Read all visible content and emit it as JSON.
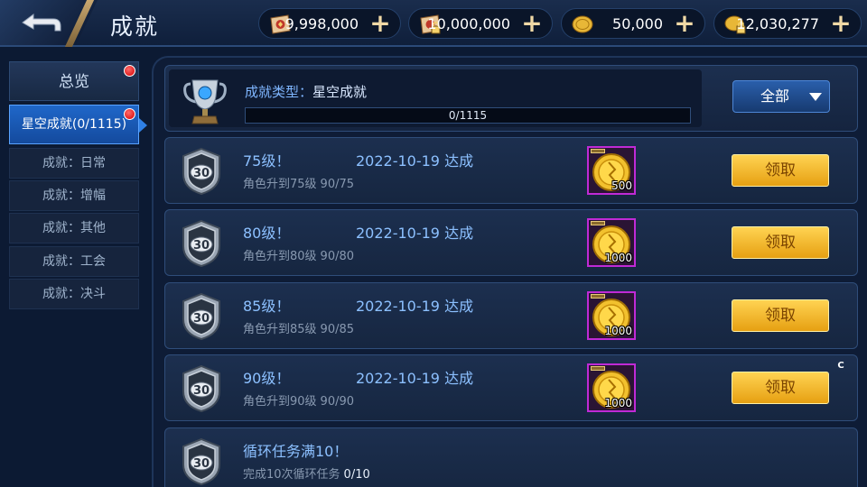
{
  "header": {
    "title": "成就",
    "currencies": [
      {
        "icon": "scroll-ticket-icon",
        "value": "9,998,000"
      },
      {
        "icon": "locked-scroll-ticket-icon",
        "value": "10,000,000"
      },
      {
        "icon": "gold-coin-icon",
        "value": "50,000"
      },
      {
        "icon": "locked-gold-coin-icon",
        "value": "12,030,277"
      }
    ],
    "plus_label": "+"
  },
  "sidebar": {
    "items": [
      {
        "label": "总览",
        "dot": true
      },
      {
        "label": "星空成就(0/1115)",
        "dot": true,
        "active": true
      },
      {
        "label": "成就：日常"
      },
      {
        "label": "成就：增幅"
      },
      {
        "label": "成就：其他"
      },
      {
        "label": "成就：工会"
      },
      {
        "label": "成就：决斗"
      }
    ]
  },
  "summary": {
    "type_label": "成就类型：",
    "type_value": "星空成就",
    "progress_text": "0/1115",
    "progress_fraction": 0,
    "filter_label": "全部"
  },
  "achievements": [
    {
      "badge": "30",
      "title": "75级！",
      "date": "2022-10-19 达成",
      "desc": "角色升到75级",
      "progress": "90/75",
      "reward_qty": "500",
      "button": "领取"
    },
    {
      "badge": "30",
      "title": "80级！",
      "date": "2022-10-19 达成",
      "desc": "角色升到80级",
      "progress": "90/80",
      "reward_qty": "1000",
      "button": "领取"
    },
    {
      "badge": "30",
      "title": "85级！",
      "date": "2022-10-19 达成",
      "desc": "角色升到85级",
      "progress": "90/85",
      "reward_qty": "1000",
      "button": "领取"
    },
    {
      "badge": "30",
      "title": "90级！",
      "date": "2022-10-19 达成",
      "desc": "角色升到90级",
      "progress": "90/90",
      "reward_qty": "1000",
      "button": "领取",
      "marker": "C"
    },
    {
      "badge": "30",
      "title": "循环任务满10！",
      "desc": "完成10次循环任务",
      "progress": "0/10"
    }
  ],
  "colors": {
    "accent_blue": "#2f80e6",
    "claim_gold": "#ffd352",
    "reward_border": "#c02ad6",
    "notify_red": "#d60000"
  }
}
